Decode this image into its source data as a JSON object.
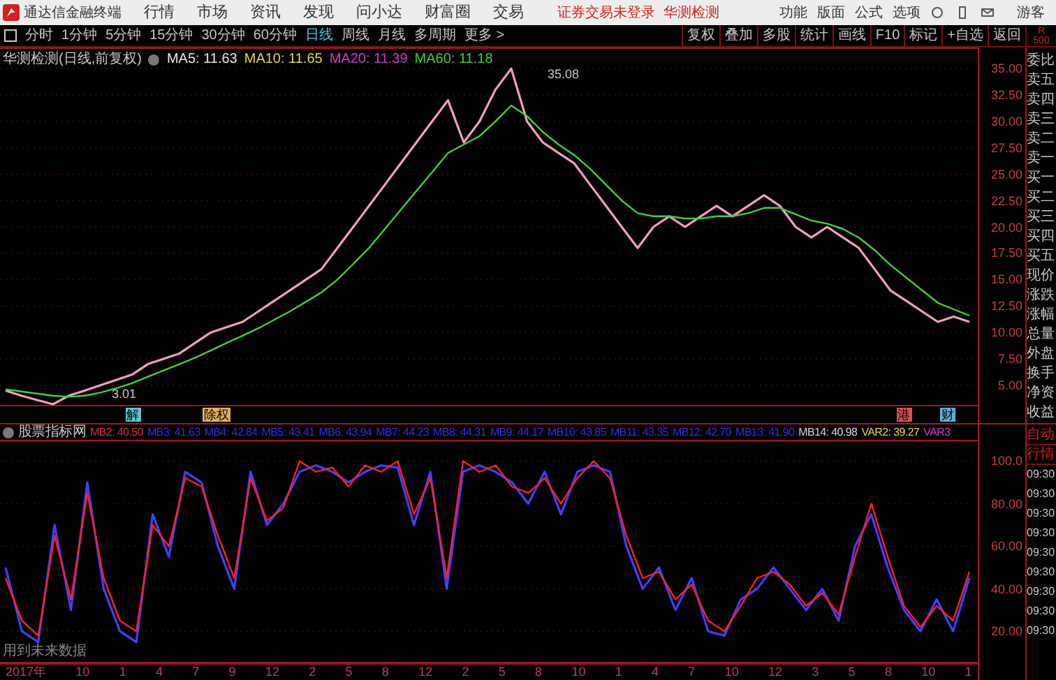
{
  "app": {
    "title": "通达信金融终端",
    "menus": [
      "行情",
      "市场",
      "资讯",
      "发现",
      "问小达",
      "财富圈",
      "交易"
    ],
    "notices": [
      "证券交易未登录",
      "华测检测"
    ],
    "right_menus": [
      "功能",
      "版面",
      "公式",
      "选项"
    ],
    "user": "游客"
  },
  "periods": [
    {
      "label": "分时",
      "selected": false
    },
    {
      "label": "1分钟",
      "selected": false
    },
    {
      "label": "5分钟",
      "selected": false
    },
    {
      "label": "15分钟",
      "selected": false
    },
    {
      "label": "30分钟",
      "selected": false
    },
    {
      "label": "60分钟",
      "selected": false
    },
    {
      "label": "日线",
      "selected": true
    },
    {
      "label": "周线",
      "selected": false
    },
    {
      "label": "月线",
      "selected": false
    },
    {
      "label": "多周期",
      "selected": false
    },
    {
      "label": "更多 >",
      "selected": false
    }
  ],
  "tools": [
    "复权",
    "叠加",
    "多股",
    "统计",
    "画线",
    "F10",
    "标记",
    "+自选",
    "返回"
  ],
  "corner": [
    "R",
    "500"
  ],
  "main_chart": {
    "title": "华测检测(日线,前复权)",
    "ma": [
      {
        "label": "MA5: 11.63",
        "color": "#e8e8e8"
      },
      {
        "label": "MA10: 11.65",
        "color": "#e8d44a"
      },
      {
        "label": "MA20: 11.39",
        "color": "#d23ad2"
      },
      {
        "label": "MA60: 11.18",
        "color": "#3fcf3f"
      }
    ],
    "high_label": "35.08",
    "low_label": "3.01",
    "chart_data": {
      "type": "line",
      "grid": true,
      "ylim": [
        3,
        37
      ],
      "yticks": [
        {
          "value": 5,
          "label": "5.00"
        },
        {
          "value": 7.5,
          "label": "7.50"
        },
        {
          "value": 10,
          "label": "10.00"
        },
        {
          "value": 12.5,
          "label": "12.50"
        },
        {
          "value": 15,
          "label": "15.00"
        },
        {
          "value": 17.5,
          "label": "17.50"
        },
        {
          "value": 20,
          "label": "20.00"
        },
        {
          "value": 22.5,
          "label": "22.50"
        },
        {
          "value": 25,
          "label": "25.00"
        },
        {
          "value": 27.5,
          "label": "27.50"
        },
        {
          "value": 30,
          "label": "30.00"
        },
        {
          "value": 32.5,
          "label": "32.50"
        },
        {
          "value": 35,
          "label": "35.00"
        }
      ],
      "series": [
        {
          "color": "#f0a0b8",
          "values": [
            4.5,
            4.0,
            3.6,
            3.2,
            4.0,
            4.5,
            5.0,
            5.5,
            6.0,
            7.0,
            7.5,
            8.0,
            9.0,
            10.0,
            10.5,
            11.0,
            12.0,
            13.0,
            14.0,
            15.0,
            16.0,
            18.0,
            20.0,
            22.0,
            24.0,
            26.0,
            28.0,
            30.0,
            32.0,
            28.0,
            30.0,
            33.0,
            35.0,
            30.0,
            28.0,
            27.0,
            26.0,
            24.0,
            22.0,
            20.0,
            18.0,
            20.0,
            21.0,
            20.0,
            21.0,
            22.0,
            21.0,
            22.0,
            23.0,
            22.0,
            20.0,
            19.0,
            20.0,
            19.0,
            18.0,
            16.0,
            14.0,
            13.0,
            12.0,
            11.0,
            11.5,
            11.0
          ]
        },
        {
          "color": "#3fcf3f",
          "values": [
            4.6,
            4.4,
            4.2,
            4.0,
            3.9,
            4.0,
            4.3,
            4.7,
            5.2,
            5.8,
            6.4,
            7.0,
            7.6,
            8.3,
            9.0,
            9.7,
            10.4,
            11.2,
            12.0,
            12.9,
            13.8,
            15.0,
            16.5,
            18.0,
            19.8,
            21.6,
            23.4,
            25.2,
            27.0,
            27.8,
            28.6,
            30.0,
            31.5,
            30.5,
            29.0,
            27.8,
            26.8,
            25.5,
            24.0,
            22.5,
            21.3,
            21.0,
            21.0,
            20.8,
            20.8,
            21.0,
            21.0,
            21.3,
            21.8,
            21.8,
            21.2,
            20.6,
            20.3,
            19.8,
            19.0,
            17.8,
            16.4,
            15.2,
            14.0,
            12.8,
            12.2,
            11.6
          ]
        }
      ]
    },
    "markers": [
      {
        "text": "解",
        "color": "#5bc8d8"
      },
      {
        "text": "除权",
        "color": "#e0b060"
      },
      {
        "text": "港",
        "color": "#e05050"
      },
      {
        "text": "财",
        "color": "#5bb0e0"
      }
    ]
  },
  "indicator": {
    "title": "股票指标网",
    "values": [
      {
        "label": "MB2: 40.50",
        "color": "#e03030"
      },
      {
        "label": "MB3: 41.63",
        "color": "#3030e0"
      },
      {
        "label": "MB4: 42.84",
        "color": "#3030e0"
      },
      {
        "label": "MB5: 43.41",
        "color": "#3030e0"
      },
      {
        "label": "MB6: 43.94",
        "color": "#3030e0"
      },
      {
        "label": "MB7: 44.23",
        "color": "#3030e0"
      },
      {
        "label": "MB8: 44.31",
        "color": "#3030e0"
      },
      {
        "label": "MB9: 44.17",
        "color": "#3030e0"
      },
      {
        "label": "MB10: 43.85",
        "color": "#3030e0"
      },
      {
        "label": "MB11: 43.35",
        "color": "#3030e0"
      },
      {
        "label": "MB12: 42.70",
        "color": "#3030e0"
      },
      {
        "label": "MB13: 41.90",
        "color": "#3030e0"
      },
      {
        "label": "MB14: 40.98",
        "color": "#d8d8d8"
      },
      {
        "label": "VAR2: 39.27",
        "color": "#e8d44a"
      },
      {
        "label": "VAR3",
        "color": "#d23ad2"
      }
    ],
    "note": "用到未来数据",
    "chart_data": {
      "type": "line",
      "grid": true,
      "ylim": [
        5,
        110
      ],
      "yticks": [
        {
          "value": 20,
          "label": "20.00"
        },
        {
          "value": 40,
          "label": "40.00"
        },
        {
          "value": 60,
          "label": "60.00"
        },
        {
          "value": 80,
          "label": "80.00"
        },
        {
          "value": 100,
          "label": "100.0"
        }
      ],
      "series": [
        {
          "color": "#4040ff",
          "values": [
            50,
            20,
            15,
            70,
            30,
            90,
            40,
            20,
            15,
            75,
            55,
            95,
            90,
            60,
            40,
            95,
            70,
            80,
            95,
            98,
            95,
            90,
            95,
            98,
            97,
            70,
            95,
            40,
            95,
            98,
            95,
            90,
            80,
            95,
            75,
            95,
            98,
            95,
            60,
            40,
            50,
            30,
            45,
            20,
            18,
            35,
            40,
            50,
            40,
            30,
            40,
            25,
            60,
            75,
            50,
            30,
            20,
            35,
            20,
            45
          ]
        },
        {
          "color": "#ff2020",
          "values": [
            45,
            25,
            18,
            65,
            35,
            85,
            45,
            25,
            20,
            70,
            60,
            92,
            88,
            65,
            45,
            92,
            72,
            78,
            100,
            95,
            97,
            88,
            98,
            95,
            100,
            75,
            92,
            45,
            100,
            95,
            98,
            88,
            85,
            92,
            80,
            92,
            100,
            92,
            65,
            45,
            48,
            35,
            42,
            25,
            20,
            32,
            45,
            48,
            42,
            32,
            38,
            28,
            55,
            80,
            55,
            32,
            22,
            32,
            25,
            48
          ]
        }
      ]
    }
  },
  "x_labels": [
    "2017年",
    "10",
    "1",
    "4",
    "7",
    "9",
    "12",
    "2",
    "5",
    "8",
    "12",
    "2",
    "5",
    "8",
    "10",
    "1",
    "4",
    "7",
    "10",
    "12",
    "3",
    "5",
    "8",
    "10",
    "1"
  ],
  "quote_labels": [
    "委比",
    "卖五",
    "卖四",
    "卖三",
    "卖二",
    "卖一",
    "买一",
    "买二",
    "买三",
    "买四",
    "买五",
    "现价",
    "涨跌",
    "涨幅",
    "总量",
    "外盘",
    "换手",
    "净资",
    "收益"
  ],
  "side_tabs": [
    "自动",
    "行情"
  ],
  "ticks": [
    "09:30",
    "09:30",
    "09:30",
    "09:30",
    "09:30",
    "09:30",
    "09:30",
    "09:30",
    "09:30"
  ]
}
